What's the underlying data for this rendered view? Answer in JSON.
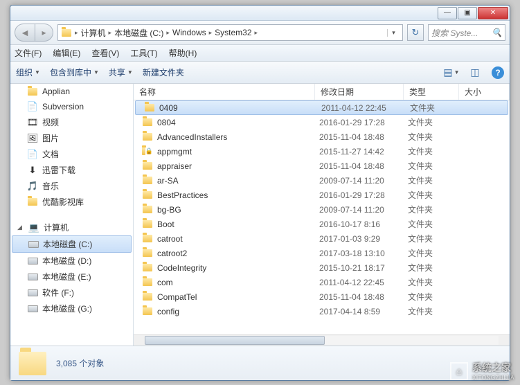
{
  "titlebar": {
    "min": "—",
    "max": "▣",
    "close": "✕"
  },
  "breadcrumbs": [
    "计算机",
    "本地磁盘 (C:)",
    "Windows",
    "System32"
  ],
  "search_placeholder": "搜索 Syste...",
  "menu": {
    "file": "文件(F)",
    "edit": "编辑(E)",
    "view": "查看(V)",
    "tools": "工具(T)",
    "help": "帮助(H)"
  },
  "cmdbar": {
    "organize": "组织",
    "include": "包含到库中",
    "share": "共享",
    "newfolder": "新建文件夹"
  },
  "sidebar": {
    "libs": [
      {
        "icon": "folder",
        "label": "Applian"
      },
      {
        "icon": "svn",
        "label": "Subversion"
      },
      {
        "icon": "video",
        "label": "视频"
      },
      {
        "icon": "image",
        "label": "图片"
      },
      {
        "icon": "doc",
        "label": "文档"
      },
      {
        "icon": "thunder",
        "label": "迅雷下载"
      },
      {
        "icon": "music",
        "label": "音乐"
      },
      {
        "icon": "folder",
        "label": "优酷影视库"
      }
    ],
    "computer_label": "计算机",
    "drives": [
      {
        "label": "本地磁盘 (C:)",
        "selected": true
      },
      {
        "label": "本地磁盘 (D:)"
      },
      {
        "label": "本地磁盘 (E:)"
      },
      {
        "label": "软件 (F:)"
      },
      {
        "label": "本地磁盘 (G:)"
      }
    ]
  },
  "columns": {
    "name": "名称",
    "date": "修改日期",
    "type": "类型",
    "size": "大小"
  },
  "files": [
    {
      "name": "0409",
      "date": "2011-04-12 22:45",
      "type": "文件夹",
      "selected": true
    },
    {
      "name": "0804",
      "date": "2016-01-29 17:28",
      "type": "文件夹"
    },
    {
      "name": "AdvancedInstallers",
      "date": "2015-11-04 18:48",
      "type": "文件夹"
    },
    {
      "name": "appmgmt",
      "date": "2015-11-27 14:42",
      "type": "文件夹",
      "lock": true
    },
    {
      "name": "appraiser",
      "date": "2015-11-04 18:48",
      "type": "文件夹"
    },
    {
      "name": "ar-SA",
      "date": "2009-07-14 11:20",
      "type": "文件夹"
    },
    {
      "name": "BestPractices",
      "date": "2016-01-29 17:28",
      "type": "文件夹"
    },
    {
      "name": "bg-BG",
      "date": "2009-07-14 11:20",
      "type": "文件夹"
    },
    {
      "name": "Boot",
      "date": "2016-10-17 8:16",
      "type": "文件夹"
    },
    {
      "name": "catroot",
      "date": "2017-01-03 9:29",
      "type": "文件夹"
    },
    {
      "name": "catroot2",
      "date": "2017-03-18 13:10",
      "type": "文件夹"
    },
    {
      "name": "CodeIntegrity",
      "date": "2015-10-21 18:17",
      "type": "文件夹"
    },
    {
      "name": "com",
      "date": "2011-04-12 22:45",
      "type": "文件夹"
    },
    {
      "name": "CompatTel",
      "date": "2015-11-04 18:48",
      "type": "文件夹"
    },
    {
      "name": "config",
      "date": "2017-04-14 8:59",
      "type": "文件夹"
    }
  ],
  "status": "3,085 个对象",
  "watermark": {
    "text": "系统之家",
    "sub": "XITONGZHIJIA"
  }
}
